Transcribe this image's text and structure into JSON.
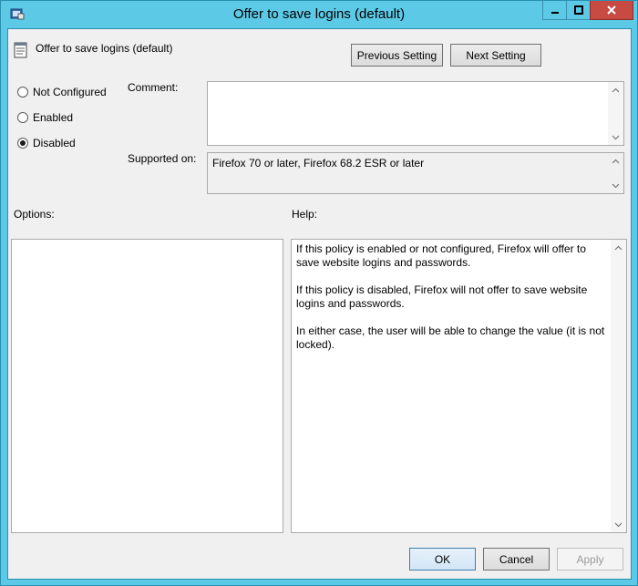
{
  "window": {
    "title": "Offer to save logins (default)"
  },
  "header": {
    "policy_title": "Offer to save logins (default)",
    "previous_button": "Previous Setting",
    "next_button": "Next Setting"
  },
  "state": {
    "options": [
      {
        "label": "Not Configured",
        "selected": false
      },
      {
        "label": "Enabled",
        "selected": false
      },
      {
        "label": "Disabled",
        "selected": true
      }
    ]
  },
  "comment": {
    "label": "Comment:",
    "value": ""
  },
  "supported": {
    "label": "Supported on:",
    "value": "Firefox 70 or later, Firefox 68.2 ESR or later"
  },
  "options_panel": {
    "label": "Options:"
  },
  "help_panel": {
    "label": "Help:",
    "paragraphs": [
      "If this policy is enabled or not configured, Firefox will offer to save website logins and passwords.",
      "If this policy is disabled, Firefox will not offer to save website logins and passwords.",
      "In either case, the user will be able to change the value (it is not locked)."
    ]
  },
  "footer": {
    "ok": "OK",
    "cancel": "Cancel",
    "apply": "Apply"
  }
}
